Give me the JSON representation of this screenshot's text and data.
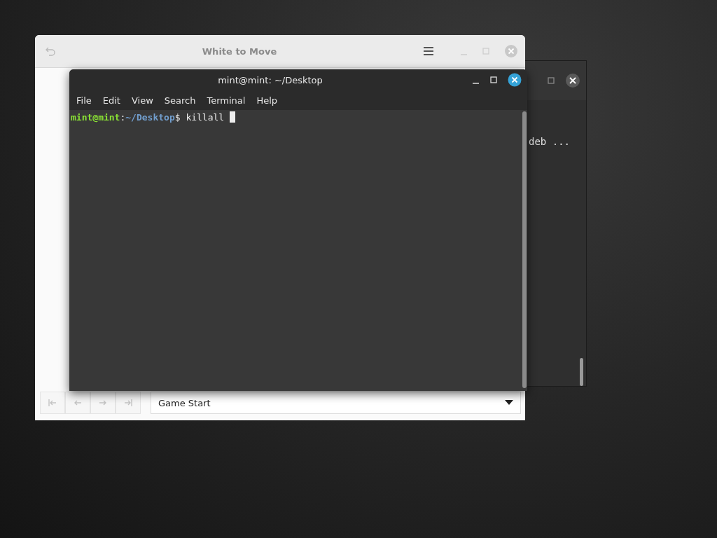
{
  "background_window": {
    "text": "deb ..."
  },
  "chess_window": {
    "title": "White to Move",
    "nav_buttons": [
      {
        "kind": "first",
        "disabled": true
      },
      {
        "kind": "previous",
        "disabled": true
      },
      {
        "kind": "next",
        "disabled": true
      },
      {
        "kind": "last",
        "disabled": true
      }
    ],
    "move_select": {
      "value": "Game Start"
    }
  },
  "terminal": {
    "title": "mint@mint: ~/Desktop",
    "menu": [
      "File",
      "Edit",
      "View",
      "Search",
      "Terminal",
      "Help"
    ],
    "prompt": {
      "user_host": "mint@mint",
      "separator": ":",
      "path": "~/Desktop",
      "symbol": "$"
    },
    "command": "killall "
  }
}
